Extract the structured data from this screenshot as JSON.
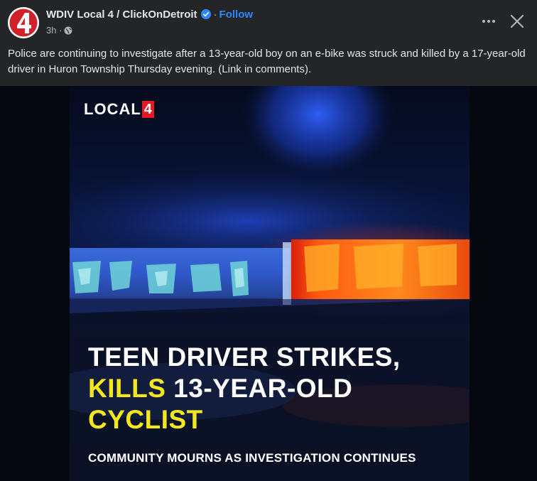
{
  "post": {
    "page_name": "WDIV Local 4 / ClickOnDetroit",
    "follow_label": "Follow",
    "time": "3h",
    "more_icon": "more-horizontal-icon",
    "close_icon": "close-icon",
    "text": "Police are continuing to investigate after a 13-year-old boy on an e-bike was struck and killed by a 17-year-old driver in Huron Township Thursday evening. (Link in comments)."
  },
  "image": {
    "logo_text": "LOCAL",
    "logo_number": "4",
    "headline_line1": "TEEN DRIVER STRIKES,",
    "headline_kills": "KILLS",
    "headline_line2_rest": " 13-YEAR-OLD",
    "headline_line3": "CYCLIST",
    "subhead": "COMMUNITY MOURNS AS INVESTIGATION CONTINUES"
  },
  "colors": {
    "background": "#242526",
    "accent_follow": "#2d88ff",
    "headline_highlight": "#f5e61d",
    "brand_red": "#e31b23"
  }
}
